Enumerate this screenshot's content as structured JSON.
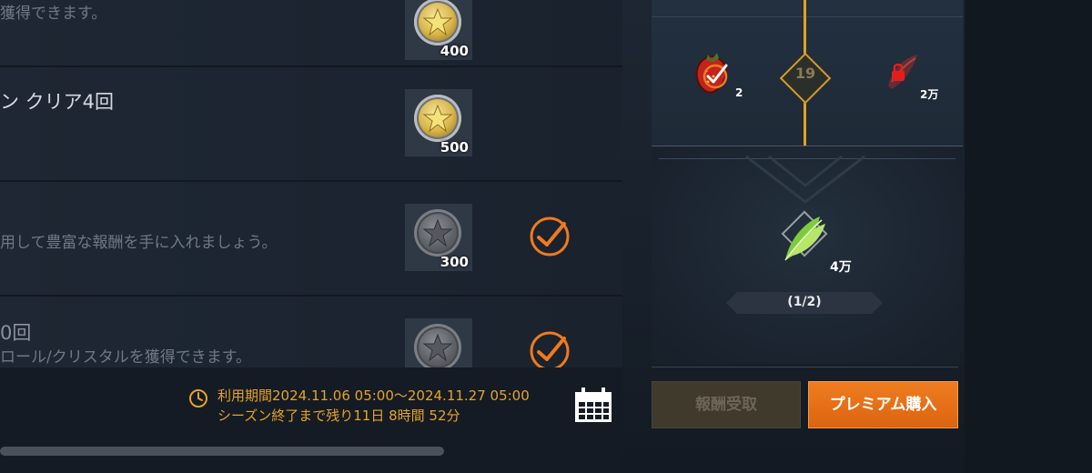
{
  "quests": [
    {
      "title": "",
      "description": "獲得できます。",
      "reward_amount": "400",
      "coin": "gold-coin",
      "completed": false
    },
    {
      "title": "ン クリア4回",
      "description": "",
      "reward_amount": "500",
      "coin": "gold-coin",
      "completed": false
    },
    {
      "title": "",
      "description": "用して豊富な報酬を手に入れましょう。",
      "reward_amount": "300",
      "coin": "silver-coin",
      "completed": true
    },
    {
      "title": "0回",
      "description": "ロール/クリスタルを獲得できます。",
      "reward_amount": "",
      "coin": "silver-coin",
      "completed": true
    }
  ],
  "period": {
    "line1": "利用期間2024.11.06 05:00～2024.11.27 05:00",
    "line2": "シーズン終了まで残り11日 8時間 52分"
  },
  "pass_track": {
    "level": "19",
    "free_reward_count": "2",
    "premium_reward_count": "2万"
  },
  "premium_preview": {
    "reward_count": "4万",
    "progress": "(1/2)"
  },
  "buttons": {
    "claim": "報酬受取",
    "buy_premium": "プレミアム購入"
  },
  "colors": {
    "accent": "#e3a21f",
    "primary_button": "#e8711a",
    "check": "#f07a1e"
  }
}
